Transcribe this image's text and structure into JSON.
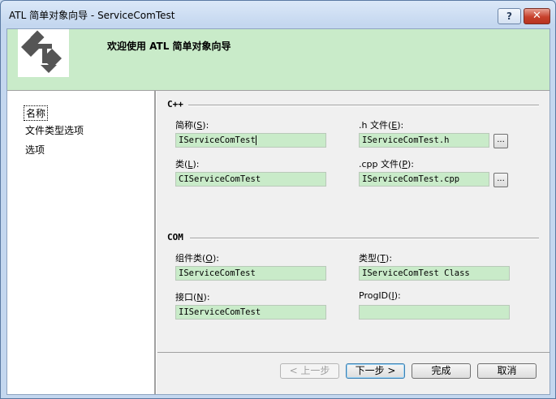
{
  "window": {
    "title": "ATL 简单对象向导 - ServiceComTest",
    "help_label": "?",
    "close_label": "✕"
  },
  "banner": {
    "title": "欢迎使用 ATL 简单对象向导",
    "logo_icon": "atl-wizard-logo-icon"
  },
  "nav": {
    "items": [
      {
        "label": "名称",
        "active": true
      },
      {
        "label": "文件类型选项",
        "active": false
      },
      {
        "label": "选项",
        "active": false
      }
    ]
  },
  "sections": {
    "cpp": "C++",
    "com": "COM"
  },
  "fields": {
    "short_name": {
      "label": "简称",
      "accel": "S",
      "value": "IServiceComTest"
    },
    "h_file": {
      "label": ".h 文件",
      "accel": "E",
      "value": "IServiceComTest.h"
    },
    "class": {
      "label": "类",
      "accel": "L",
      "value": "CIServiceComTest"
    },
    "cpp_file": {
      "label": ".cpp 文件",
      "accel": "P",
      "value": "IServiceComTest.cpp"
    },
    "coclass": {
      "label": "组件类",
      "accel": "O",
      "value": "IServiceComTest"
    },
    "type": {
      "label": "类型",
      "accel": "T",
      "value": "IServiceComTest Class"
    },
    "interface": {
      "label": "接口",
      "accel": "N",
      "value": "IIServiceComTest"
    },
    "progid": {
      "label": "ProgID",
      "accel": "I",
      "value": ""
    }
  },
  "browse_label": "...",
  "buttons": {
    "back": "< 上一步",
    "next": "下一步 >",
    "finish": "完成",
    "cancel": "取消"
  },
  "colors": {
    "banner_bg": "#c9ebc9",
    "field_bg": "#c9ebc9",
    "close_red": "#c7412c"
  }
}
